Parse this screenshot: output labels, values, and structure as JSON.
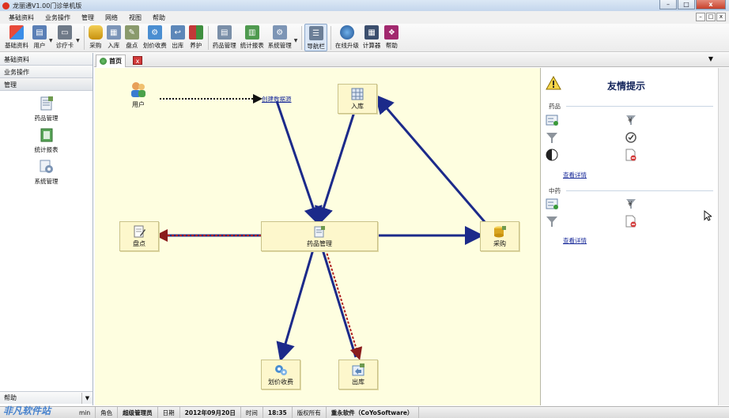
{
  "window": {
    "title": "龙丽通V1.00门诊单机版",
    "buttons": [
      "–",
      "□",
      "x"
    ]
  },
  "menubar": {
    "items": [
      "基础资料",
      "业务操作",
      "管理",
      "网络",
      "视图",
      "帮助"
    ],
    "mini_controls": [
      "–",
      "□",
      "x"
    ]
  },
  "toolbar": {
    "buttons": [
      {
        "label": "基础资料",
        "icon": "palette-icon",
        "color": "#e84a3a"
      },
      {
        "label": "用户",
        "icon": "user-card-icon",
        "color": "#5a7fb6"
      },
      {
        "label": "诊疗卡",
        "icon": "card-icon",
        "color": "#6f7a88"
      },
      {
        "label": "采购",
        "icon": "cylinder-icon",
        "color": "#d9a520"
      },
      {
        "label": "入库",
        "icon": "grid-icon",
        "color": "#7c95b8"
      },
      {
        "label": "盘点",
        "icon": "pencil-doc-icon",
        "color": "#8a9a6c"
      },
      {
        "label": "划价收费",
        "icon": "gears-icon",
        "color": "#4a8ed1"
      },
      {
        "label": "出库",
        "icon": "return-icon",
        "color": "#5d87b9"
      },
      {
        "label": "养护",
        "icon": "book-icon",
        "color": "#c23838"
      },
      {
        "label": "药品管理",
        "icon": "drug-doc-icon",
        "color": "#7a8fa8"
      },
      {
        "label": "统计报表",
        "icon": "chart-doc-icon",
        "color": "#4f9a4f"
      },
      {
        "label": "系统管理",
        "icon": "settings-doc-icon",
        "color": "#7d95b5"
      },
      {
        "label": "导航栏",
        "icon": "nav-icon",
        "color": "#6c7f97"
      },
      {
        "label": "在线升级",
        "icon": "globe-icon",
        "color": "#2f6cb5"
      },
      {
        "label": "计算器",
        "icon": "calculator-icon",
        "color": "#3b4e6d"
      },
      {
        "label": "帮助",
        "icon": "help-book-icon",
        "color": "#a2286e"
      }
    ]
  },
  "leftpanel": {
    "headers": [
      "基础资料",
      "业务操作",
      "管理"
    ],
    "items": [
      {
        "label": "药品管理",
        "icon": "drug-doc-icon"
      },
      {
        "label": "统计报表",
        "icon": "chart-doc-icon"
      },
      {
        "label": "系统管理",
        "icon": "settings-doc-icon"
      }
    ],
    "bottom": "帮助"
  },
  "tabs": {
    "home": "首页",
    "close": "x",
    "menu_arrow": "▼"
  },
  "canvas": {
    "user_label": "用户",
    "create_link": "创建数据源",
    "nodes": {
      "ruku": "入库",
      "pandian": "盘点",
      "yaopin": "药品管理",
      "caigou": "采购",
      "huajia": "划价收费",
      "chuku": "出库"
    }
  },
  "rightpanel": {
    "title": "友情提示",
    "section1": "药品",
    "section2": "中药",
    "link1": "查看详情",
    "link2": "查看详情"
  },
  "statusbar": {
    "cells": [
      {
        "text": "min",
        "bold": false
      },
      {
        "text": "角色",
        "bold": false
      },
      {
        "text": "超级管理员",
        "bold": true
      },
      {
        "text": "日期",
        "bold": false
      },
      {
        "text": "2012年09月20日",
        "bold": true
      },
      {
        "text": "时间",
        "bold": false
      },
      {
        "text": "18:35",
        "bold": true
      },
      {
        "text": "版权所有",
        "bold": false
      },
      {
        "text": "重永软件（CoYoSoftware）",
        "bold": true
      }
    ],
    "watermark": "非凡软件站"
  }
}
